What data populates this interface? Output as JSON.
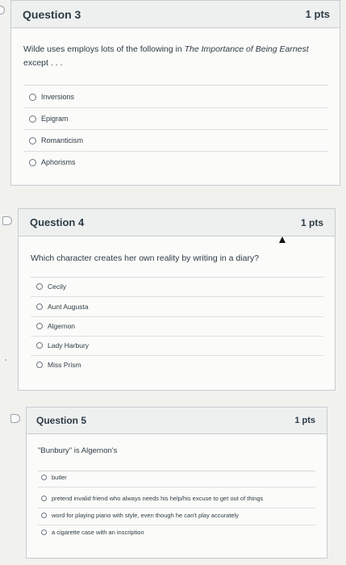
{
  "questions": [
    {
      "title": "Question 3",
      "points": "1 pts",
      "text_plain": "Wilde uses employs lots of the following in ",
      "text_italic": "The Importance of Being Earnest",
      "text_tail": " except . . .",
      "answers": [
        "Inversions",
        "Epigram",
        "Romanticism",
        "Aphorisms"
      ]
    },
    {
      "title": "Question 4",
      "points": "1 pts",
      "text": "Which character creates her own reality by writing in a diary?",
      "answers": [
        "Cecily",
        "Aunt Augusta",
        "Algernon",
        "Lady Harbury",
        "Miss Prism"
      ]
    },
    {
      "title": "Question 5",
      "points": "1 pts",
      "text": "\"Bunbury\" is Algernon's",
      "answers": [
        "butler",
        "pretend invalid friend who always needs his help/his excuse to get out of things",
        "word for playing piano with style, even though he can't play accurately",
        "a cigarette case with an inscription"
      ]
    }
  ]
}
